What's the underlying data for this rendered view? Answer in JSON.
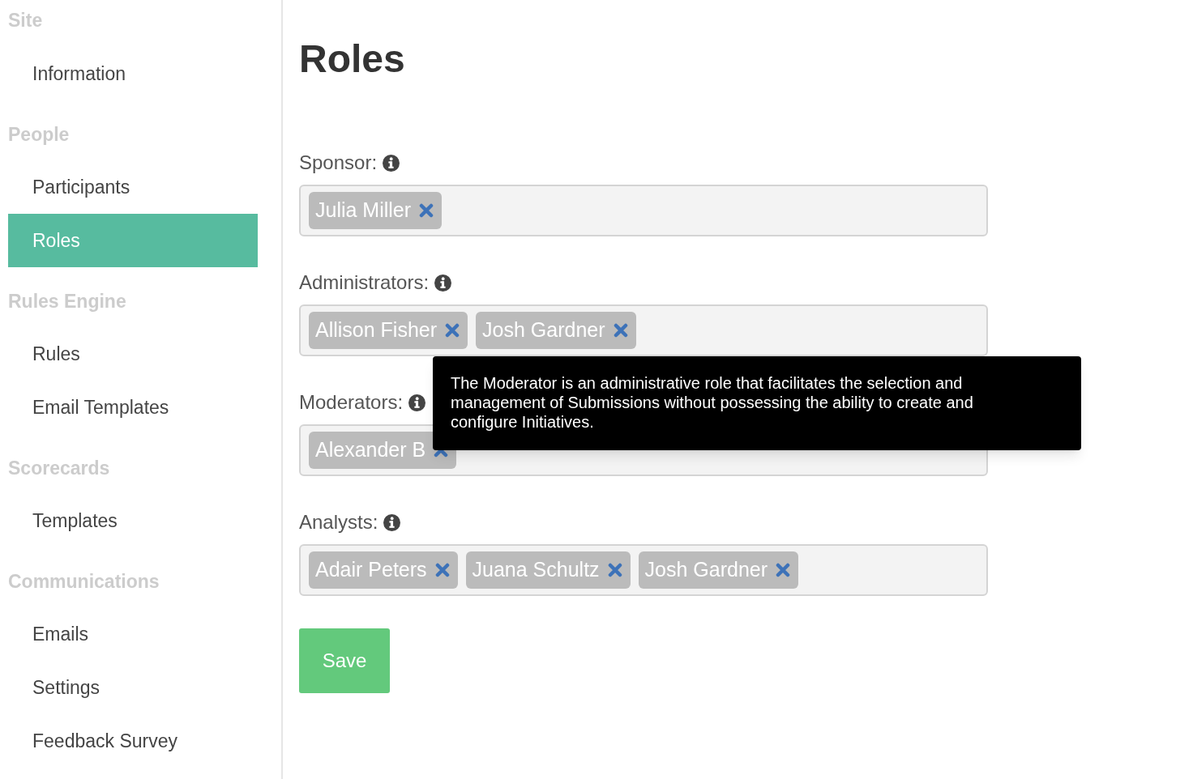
{
  "sidebar": {
    "sections": [
      {
        "title": "Site",
        "items": [
          {
            "label": "Information",
            "selected": false
          }
        ]
      },
      {
        "title": "People",
        "items": [
          {
            "label": "Participants",
            "selected": false
          },
          {
            "label": "Roles",
            "selected": true
          }
        ]
      },
      {
        "title": "Rules Engine",
        "items": [
          {
            "label": "Rules",
            "selected": false
          },
          {
            "label": "Email Templates",
            "selected": false
          }
        ]
      },
      {
        "title": "Scorecards",
        "items": [
          {
            "label": "Templates",
            "selected": false
          }
        ]
      },
      {
        "title": "Communications",
        "items": [
          {
            "label": "Emails",
            "selected": false
          },
          {
            "label": "Settings",
            "selected": false
          },
          {
            "label": "Feedback Survey",
            "selected": false
          }
        ]
      }
    ]
  },
  "page": {
    "title": "Roles",
    "fields": [
      {
        "label": "Sponsor:",
        "tags": [
          "Julia Miller"
        ]
      },
      {
        "label": "Administrators:",
        "tags": [
          "Allison Fisher",
          "Josh Gardner"
        ]
      },
      {
        "label": "Moderators:",
        "tags": [
          "Alexander B"
        ]
      },
      {
        "label": "Analysts:",
        "tags": [
          "Adair Peters",
          "Juana Schultz",
          "Josh Gardner"
        ]
      }
    ],
    "tooltip": "The Moderator is an administrative role that facilitates the selection and management of Submissions without possessing the ability to create and configure Initiatives.",
    "save_button": "Save"
  }
}
